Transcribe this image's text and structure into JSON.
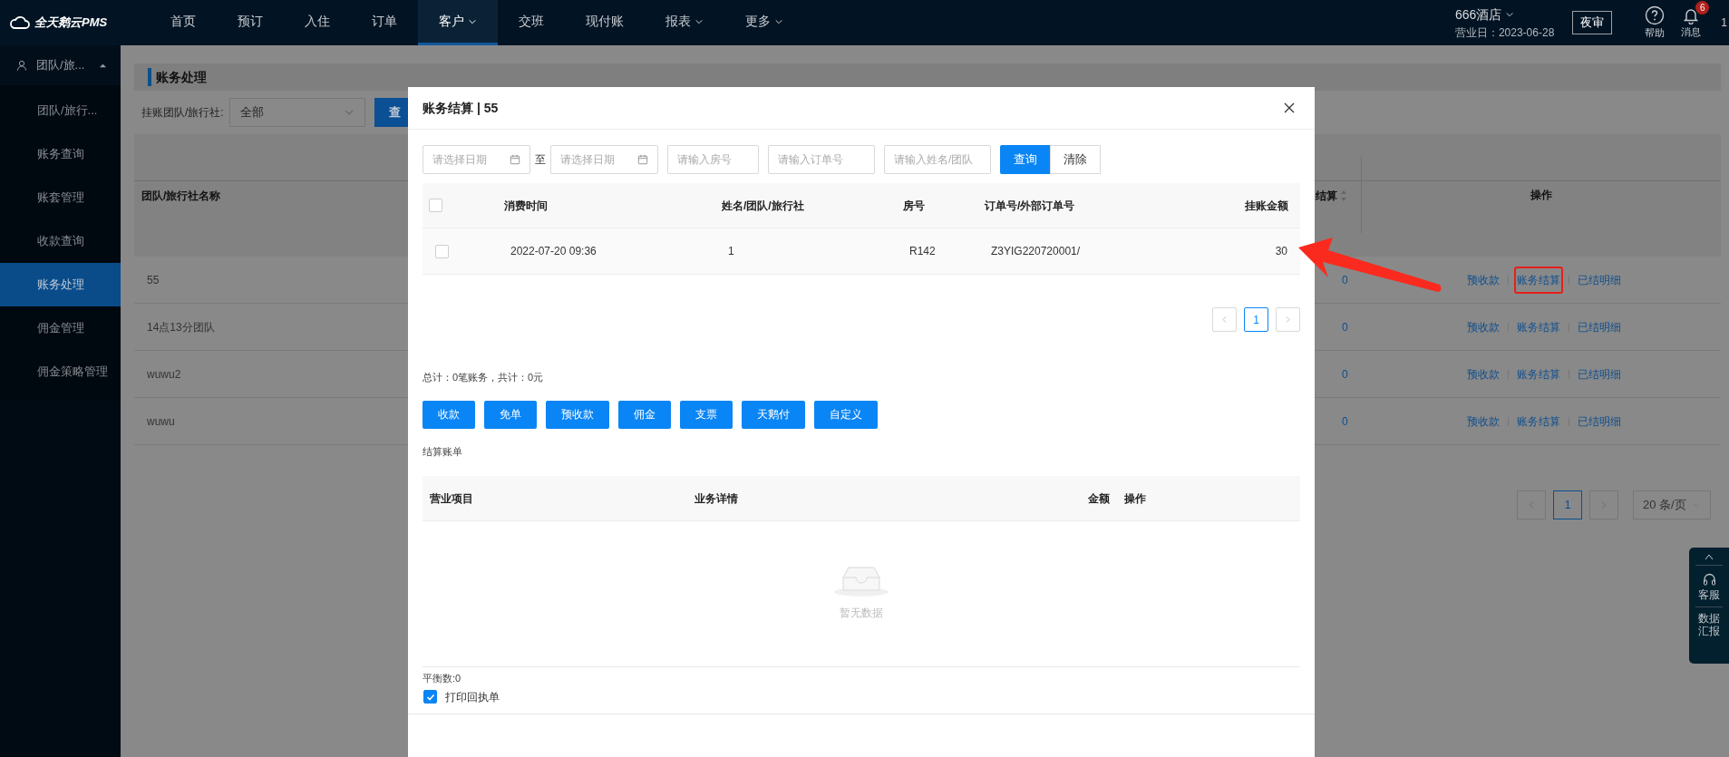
{
  "top_nav": {
    "logo": "全天鹅云PMS",
    "items": [
      {
        "label": "首页",
        "selected": false,
        "dropdown": false
      },
      {
        "label": "预订",
        "selected": false,
        "dropdown": false
      },
      {
        "label": "入住",
        "selected": false,
        "dropdown": false
      },
      {
        "label": "订单",
        "selected": false,
        "dropdown": false
      },
      {
        "label": "客户",
        "selected": true,
        "dropdown": true
      },
      {
        "label": "交班",
        "selected": false,
        "dropdown": false
      },
      {
        "label": "现付账",
        "selected": false,
        "dropdown": false
      },
      {
        "label": "报表",
        "selected": false,
        "dropdown": true
      },
      {
        "label": "更多",
        "selected": false,
        "dropdown": true
      }
    ],
    "hotel": "666酒店",
    "business_date": "营业日：2023-06-28",
    "night_audit": "夜审",
    "help": "帮助",
    "messages": {
      "label": "消息",
      "badge": "6"
    },
    "user": "1"
  },
  "sidebar": {
    "group": "团队/旅...",
    "expanded": true,
    "items": [
      {
        "label": "团队/旅行...",
        "selected": false
      },
      {
        "label": "账务查询",
        "selected": false
      },
      {
        "label": "账套管理",
        "selected": false
      },
      {
        "label": "收款查询",
        "selected": false
      },
      {
        "label": "账务处理",
        "selected": true
      },
      {
        "label": "佣金管理",
        "selected": false
      },
      {
        "label": "佣金策略管理",
        "selected": false
      }
    ]
  },
  "page": {
    "title": "账务处理",
    "filter": {
      "label": "挂账团队/旅行社:",
      "select": "全部",
      "button": "查"
    },
    "table": {
      "columns": [
        "团队/旅行社名称",
        "结算",
        "操作"
      ],
      "rows": [
        {
          "name": "55",
          "settled": "0",
          "actions": [
            {
              "label": "预收款",
              "highlighted": false
            },
            {
              "label": "账务结算",
              "highlighted": true
            },
            {
              "label": "已结明细",
              "highlighted": false
            }
          ]
        },
        {
          "name": "14点13分团队",
          "settled": "0",
          "actions": [
            {
              "label": "预收款",
              "highlighted": false
            },
            {
              "label": "账务结算",
              "highlighted": false
            },
            {
              "label": "已结明细",
              "highlighted": false
            }
          ]
        },
        {
          "name": "wuwu2",
          "settled": "0",
          "actions": [
            {
              "label": "预收款",
              "highlighted": false
            },
            {
              "label": "账务结算",
              "highlighted": false
            },
            {
              "label": "已结明细",
              "highlighted": false
            }
          ]
        },
        {
          "name": "wuwu",
          "settled": "0",
          "actions": [
            {
              "label": "预收款",
              "highlighted": false
            },
            {
              "label": "账务结算",
              "highlighted": false
            },
            {
              "label": "已结明细",
              "highlighted": false
            }
          ]
        }
      ]
    },
    "pagination": {
      "page": "1",
      "page_size": "20 条/页"
    }
  },
  "side_widget": {
    "customer_service": "客服",
    "report": "数据汇报"
  },
  "annotation": {
    "kind": "arrow"
  },
  "modal": {
    "title": "账务结算 | 55",
    "filters": {
      "date_from": {
        "placeholder": "请选择日期"
      },
      "to": "至",
      "date_to": {
        "placeholder": "请选择日期"
      },
      "room": {
        "placeholder": "请输入房号"
      },
      "order": {
        "placeholder": "请输入订单号"
      },
      "name": {
        "placeholder": "请输入姓名/团队"
      },
      "search": "查询",
      "clear": "清除"
    },
    "table": {
      "columns": [
        "消费时间",
        "姓名/团队/旅行社",
        "房号",
        "订单号/外部订单号",
        "挂账金额"
      ],
      "all_checked": false,
      "rows": [
        {
          "checked": false,
          "cells": [
            "2022-07-20 09:36",
            "1",
            "R142",
            "Z3YIG220720001/",
            "30"
          ]
        }
      ]
    },
    "pagination": {
      "page": "1"
    },
    "summary": "总计：0笔账务，共计：0元",
    "actions": [
      "收款",
      "免单",
      "预收款",
      "佣金",
      "支票",
      "天鹅付",
      "自定义"
    ],
    "bill_title": "结算账单",
    "bill_table": {
      "columns": [
        "营业项目",
        "业务详情",
        "金额",
        "操作"
      ],
      "empty_text": "暂无数据"
    },
    "balance": "平衡数:0",
    "print_receipt": {
      "label": "打印回执单",
      "checked": true
    }
  }
}
